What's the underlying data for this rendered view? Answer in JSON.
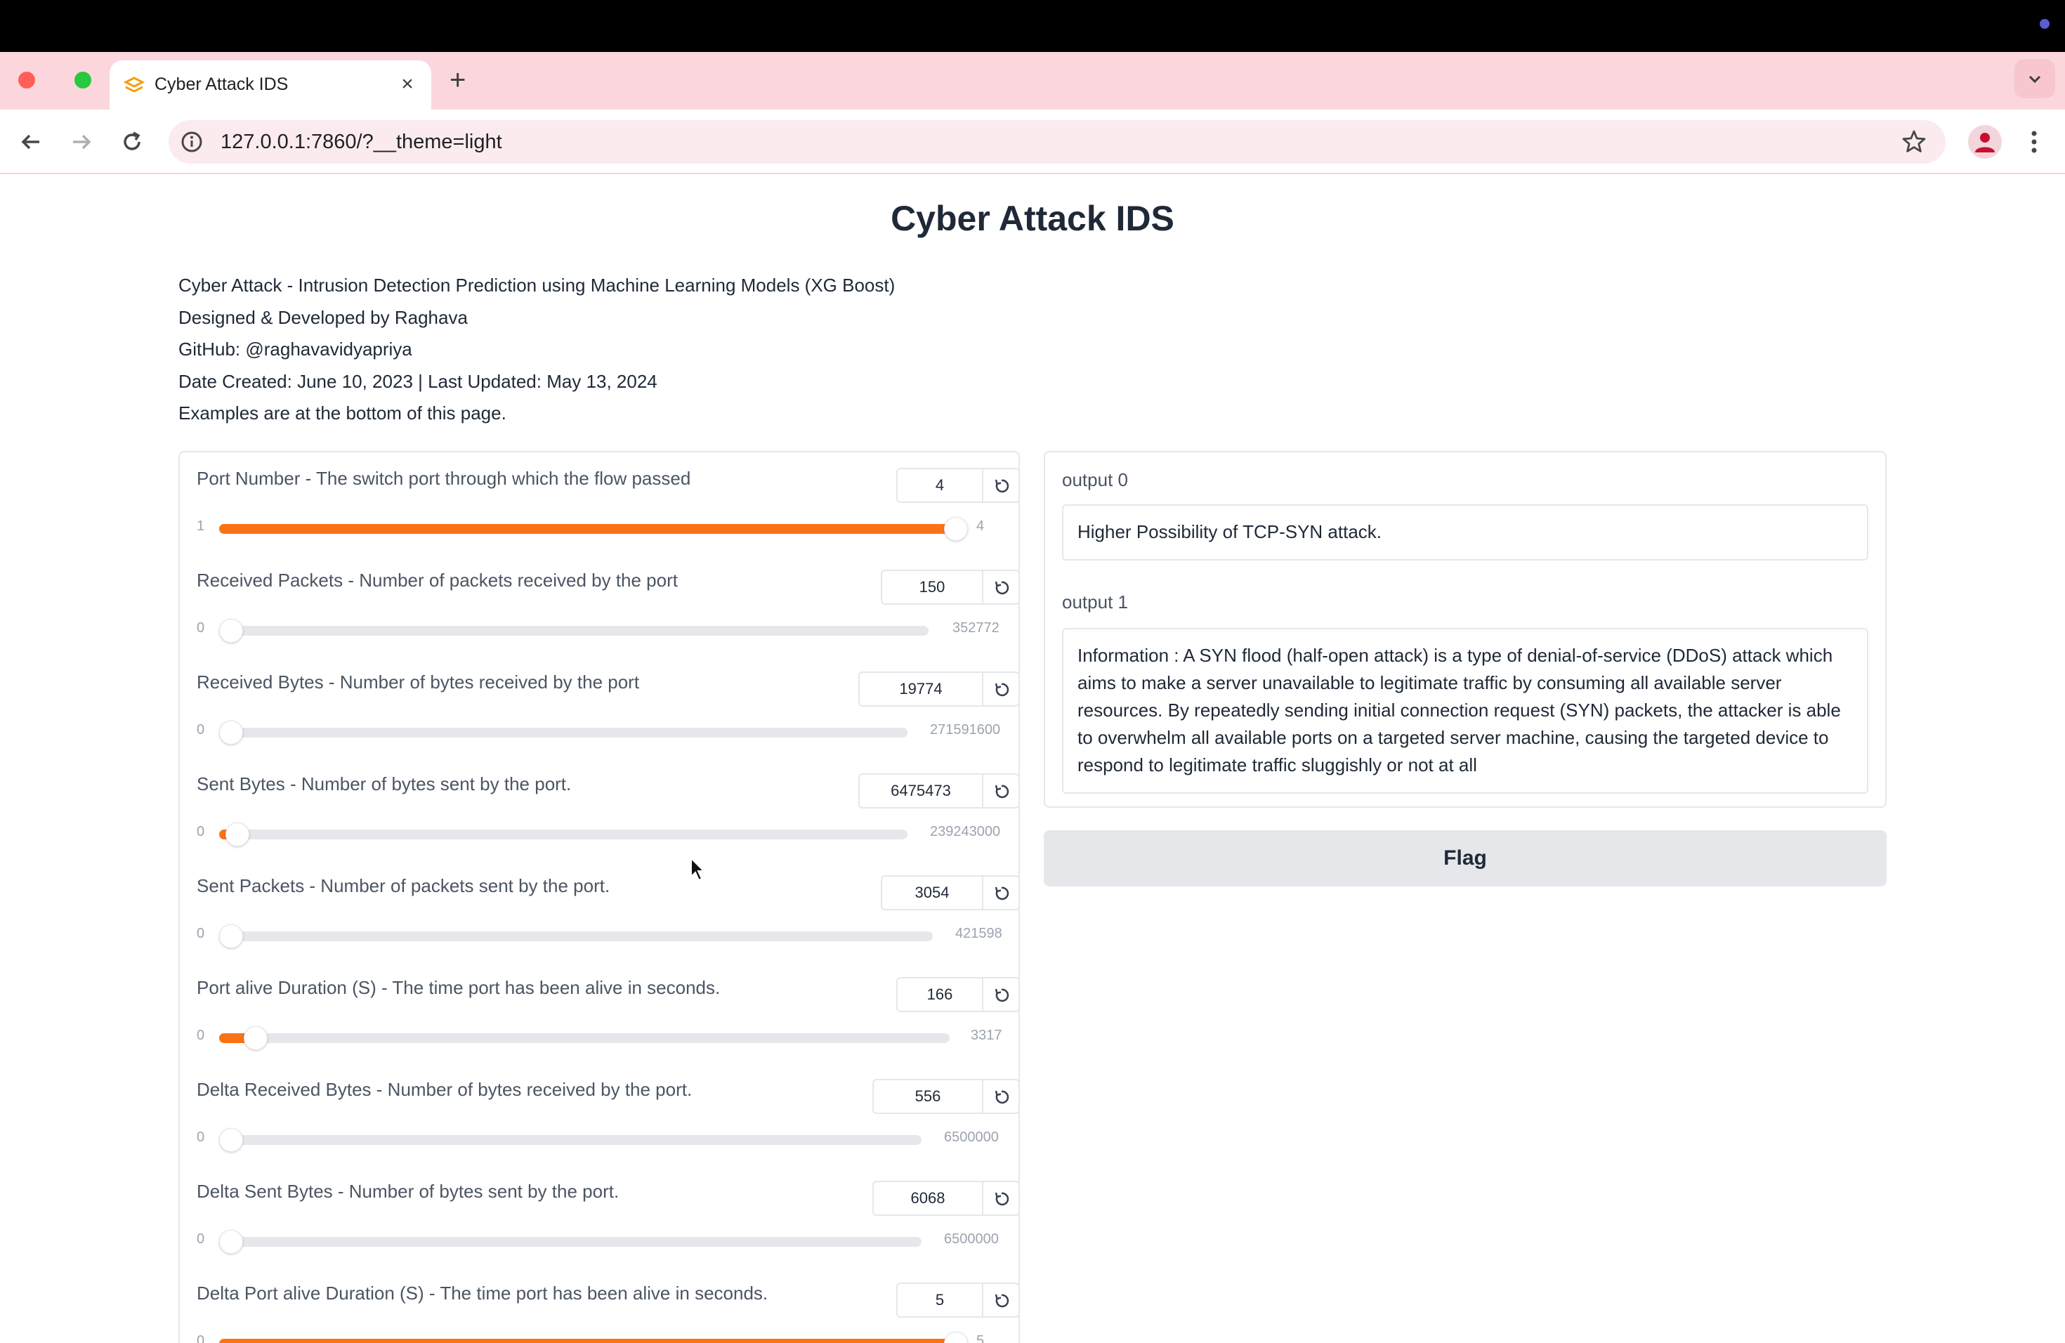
{
  "browser": {
    "tab_title": "Cyber Attack IDS",
    "url": "127.0.0.1:7860/?__theme=light"
  },
  "page": {
    "title": "Cyber Attack IDS",
    "description": [
      "Cyber Attack - Intrusion Detection Prediction using Machine Learning Models (XG Boost)",
      "Designed & Developed by Raghava",
      "GitHub: @raghavavidyapriya",
      "Date Created: June 10, 2023 | Last Updated: May 13, 2024",
      "Examples are at the bottom of this page."
    ]
  },
  "inputs": [
    {
      "label": "Port Number - The switch port through which the flow passed",
      "value": "4",
      "min": "1",
      "max": "4",
      "fraction": 1.0
    },
    {
      "label": "Received Packets - Number of packets received by the port",
      "value": "150",
      "min": "0",
      "max": "352772",
      "fraction": 0.0
    },
    {
      "label": "Received Bytes - Number of bytes received by the port",
      "value": "19774",
      "min": "0",
      "max": "271591600",
      "fraction": 0.0
    },
    {
      "label": "Sent Bytes - Number of bytes sent by the port.",
      "value": "6475473",
      "min": "0",
      "max": "239243000",
      "fraction": 0.027
    },
    {
      "label": "Sent Packets - Number of packets sent by the port.",
      "value": "3054",
      "min": "0",
      "max": "421598",
      "fraction": 0.007
    },
    {
      "label": "Port alive Duration (S) - The time port has been alive in seconds.",
      "value": "166",
      "min": "0",
      "max": "3317",
      "fraction": 0.05
    },
    {
      "label": "Delta Received Bytes - Number of bytes received by the port.",
      "value": "556",
      "min": "0",
      "max": "6500000",
      "fraction": 0.0
    },
    {
      "label": "Delta Sent Bytes - Number of bytes sent by the port.",
      "value": "6068",
      "min": "0",
      "max": "6500000",
      "fraction": 0.0
    },
    {
      "label": "Delta Port alive Duration (S) - The time port has been alive in seconds.",
      "value": "5",
      "min": "0",
      "max": "5",
      "fraction": 1.0
    }
  ],
  "outputs": {
    "output0_label": "output 0",
    "output0_text": "Higher Possibility of TCP-SYN attack.",
    "output1_label": "output 1",
    "output1_text": "Information : A SYN flood (half-open attack) is a type of denial-of-service (DDoS) attack which aims to make a server unavailable to legitimate traffic by consuming all available server resources. By repeatedly sending initial connection request (SYN) packets, the attacker is able to overwhelm all available ports on a targeted server machine, causing the targeted device to respond to legitimate traffic sluggishly or not at all"
  },
  "flag_label": "Flag",
  "colors": {
    "accent": "#f97316",
    "tab_strip": "#fbd7dd",
    "track": "#e5e7eb"
  }
}
